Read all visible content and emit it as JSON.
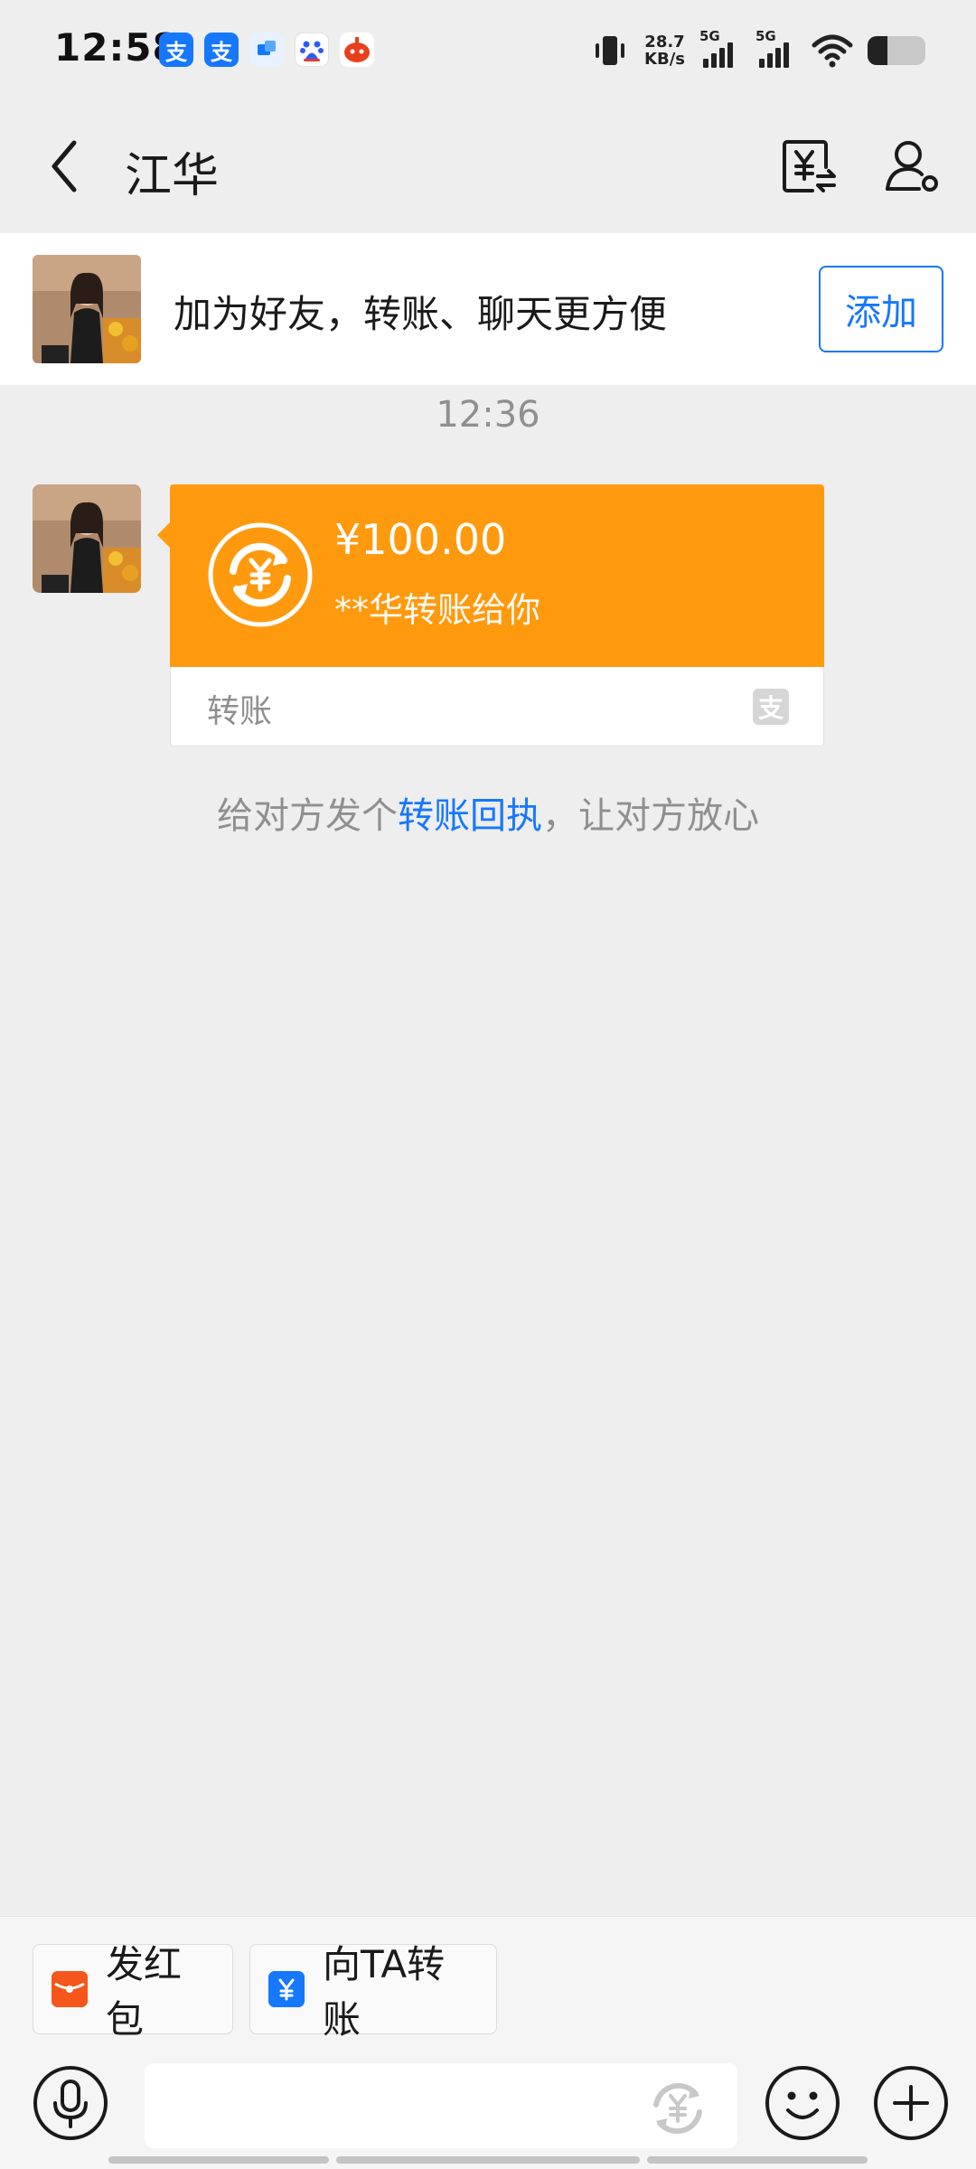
{
  "status_bar": {
    "time": "12:58",
    "notification_icons": [
      "alipay-icon",
      "alipay-icon",
      "app-icon",
      "baidu-icon",
      "red-app-icon"
    ],
    "net_speed_value": "28.7",
    "net_speed_unit": "KB/s",
    "network_1": "5G",
    "network_2": "5G",
    "battery_level": 0.35
  },
  "header": {
    "contact_name": "江华"
  },
  "add_friend_banner": {
    "text": "加为好友，转账、聊天更方便",
    "add_button": "添加"
  },
  "chat": {
    "timestamp": "12:36",
    "transfer_card": {
      "amount": "¥100.00",
      "description": "**华转账给你",
      "label": "转账",
      "accent_color": "#ff9a0f"
    },
    "receipt_hint": {
      "before": "给对方发个",
      "link": "转账回执",
      "after": "，让对方放心"
    }
  },
  "quick_actions": {
    "red_packet": "发红包",
    "transfer_to_ta": "向TA转账"
  },
  "input": {
    "placeholder": ""
  },
  "colors": {
    "brand_blue": "#1677ff",
    "transfer_orange": "#ff9a0f",
    "red_packet": "#f5561b"
  }
}
